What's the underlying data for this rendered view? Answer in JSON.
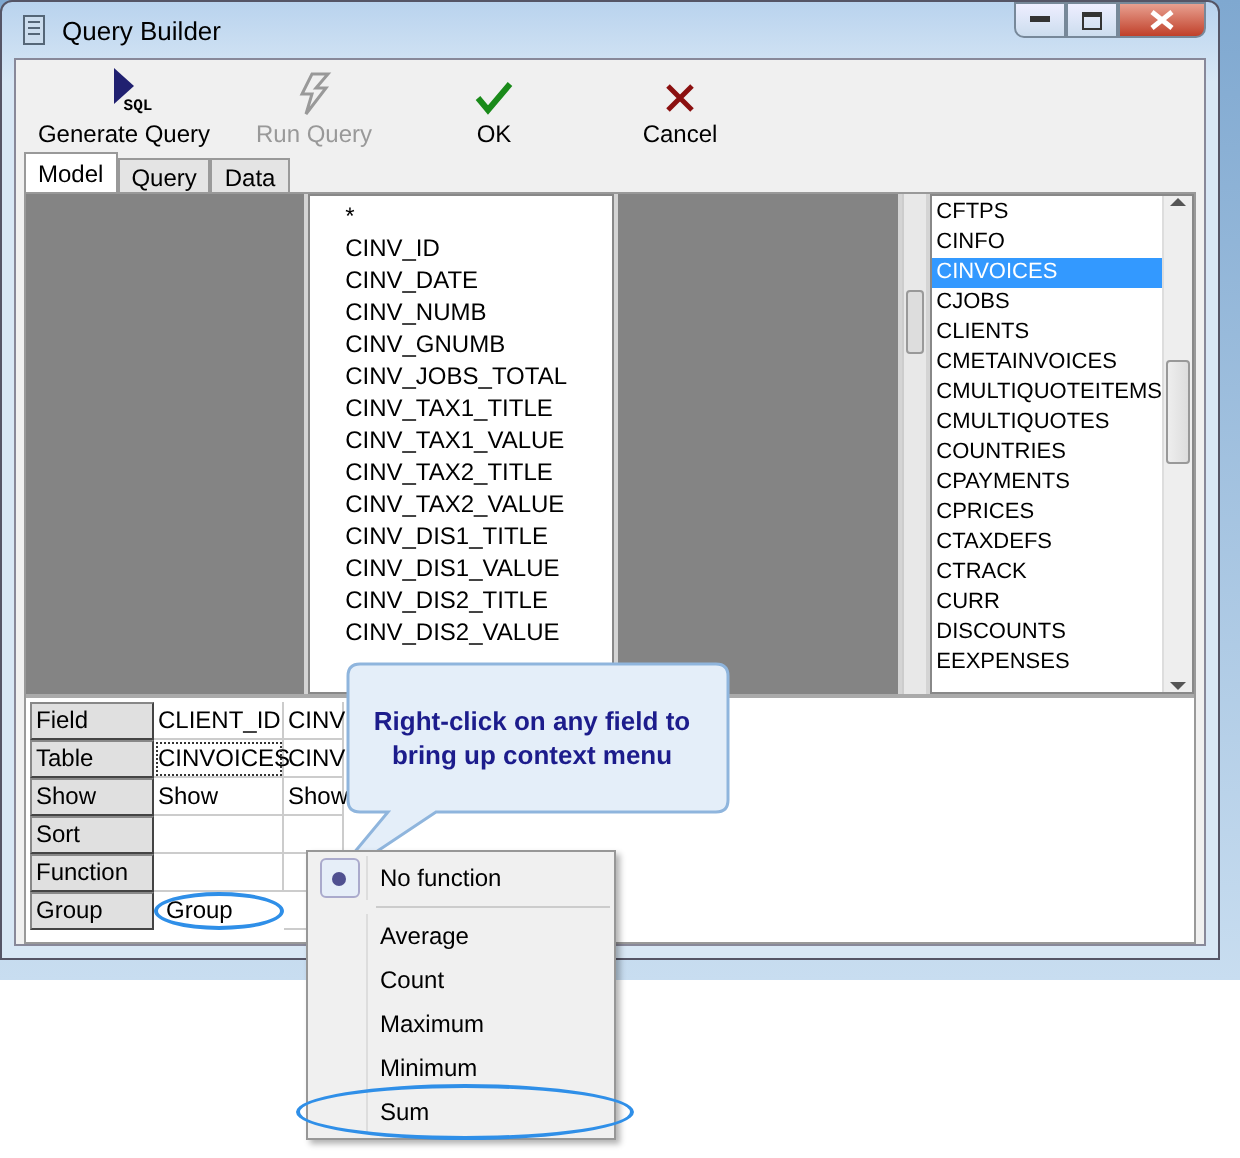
{
  "window": {
    "title": "Query Builder"
  },
  "toolbar": [
    {
      "label": "Generate Query",
      "icon_text": "SQL",
      "disabled": false
    },
    {
      "label": "Run Query",
      "disabled": true
    },
    {
      "label": "OK",
      "disabled": false
    },
    {
      "label": "Cancel",
      "disabled": false
    }
  ],
  "tabs": [
    {
      "label": "Model",
      "selected": true
    },
    {
      "label": "Query",
      "selected": false
    },
    {
      "label": "Data",
      "selected": false
    }
  ],
  "fields": [
    "*",
    "CINV_ID",
    "CINV_DATE",
    "CINV_NUMB",
    "CINV_GNUMB",
    "CINV_JOBS_TOTAL",
    "CINV_TAX1_TITLE",
    "CINV_TAX1_VALUE",
    "CINV_TAX2_TITLE",
    "CINV_TAX2_VALUE",
    "CINV_DIS1_TITLE",
    "CINV_DIS1_VALUE",
    "CINV_DIS2_TITLE",
    "CINV_DIS2_VALUE"
  ],
  "tables": [
    {
      "name": "CFTPS",
      "selected": false
    },
    {
      "name": "CINFO",
      "selected": false
    },
    {
      "name": "CINVOICES",
      "selected": true
    },
    {
      "name": "CJOBS",
      "selected": false
    },
    {
      "name": "CLIENTS",
      "selected": false
    },
    {
      "name": "CMETAINVOICES",
      "selected": false
    },
    {
      "name": "CMULTIQUOTEITEMS",
      "selected": false
    },
    {
      "name": "CMULTIQUOTES",
      "selected": false
    },
    {
      "name": "COUNTRIES",
      "selected": false
    },
    {
      "name": "CPAYMENTS",
      "selected": false
    },
    {
      "name": "CPRICES",
      "selected": false
    },
    {
      "name": "CTAXDEFS",
      "selected": false
    },
    {
      "name": "CTRACK",
      "selected": false
    },
    {
      "name": "CURR",
      "selected": false
    },
    {
      "name": "DISCOUNTS",
      "selected": false
    },
    {
      "name": "EEXPENSES",
      "selected": false
    }
  ],
  "grid": [
    {
      "label": "Field",
      "cells": [
        {
          "text": "CLIENT_ID",
          "circled": false,
          "focused": false
        },
        {
          "text": "CINV",
          "circled": false,
          "focused": false
        }
      ]
    },
    {
      "label": "Table",
      "cells": [
        {
          "text": "CINVOICES",
          "circled": false,
          "focused": true
        },
        {
          "text": "CINV",
          "circled": false,
          "focused": false
        }
      ]
    },
    {
      "label": "Show",
      "cells": [
        {
          "text": "Show",
          "circled": false,
          "focused": false
        },
        {
          "text": "Show",
          "circled": false,
          "focused": false
        }
      ]
    },
    {
      "label": "Sort"
    },
    {
      "label": "Function"
    },
    {
      "label": "Group",
      "cells": [
        {
          "text": "Group",
          "circled": true,
          "focused": false
        }
      ]
    }
  ],
  "callout": {
    "text": "Right-click on any field to bring up context menu"
  },
  "context_menu": {
    "groups": [
      [
        {
          "label": "No function",
          "selected": true,
          "circled": false
        }
      ],
      [
        {
          "label": "Average",
          "selected": false,
          "circled": false
        },
        {
          "label": "Count",
          "selected": false,
          "circled": false
        },
        {
          "label": "Maximum",
          "selected": false,
          "circled": false
        },
        {
          "label": "Minimum",
          "selected": false,
          "circled": false
        },
        {
          "label": "Sum",
          "selected": false,
          "circled": true
        }
      ]
    ]
  }
}
